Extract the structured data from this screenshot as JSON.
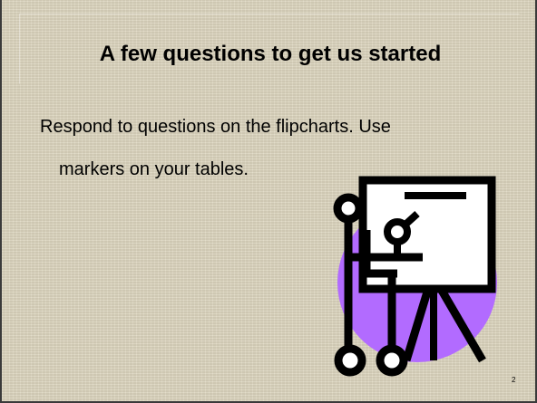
{
  "slide": {
    "title": "A few questions to get us started",
    "body_line_1": "Respond to questions on the flipcharts.  Use",
    "body_line_2": "markers on your tables.",
    "page_number": "2"
  },
  "clipart": {
    "icon": "presenter-at-flipchart-icon",
    "colors": {
      "circle": "#b26bff",
      "lines": "#000000",
      "board": "#ffffff"
    }
  },
  "colors": {
    "background": "#ddd6bf",
    "text": "#000000"
  }
}
